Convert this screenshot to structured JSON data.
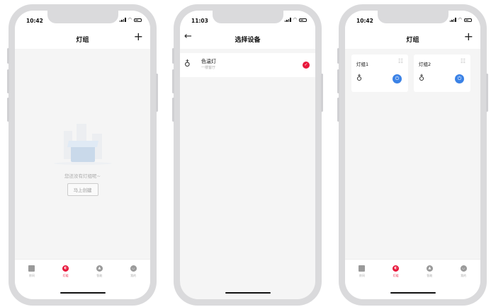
{
  "screens": [
    {
      "time": "10:42",
      "title": "灯组",
      "add_icon": "plus-icon",
      "empty_text": "您还没有灯组呢~",
      "create_button": "马上创建",
      "tabs": [
        {
          "label": "房间",
          "icon": "room-icon",
          "active": false
        },
        {
          "label": "灯组",
          "icon": "light-group-icon",
          "active": true
        },
        {
          "label": "智能",
          "icon": "smart-icon",
          "active": false
        },
        {
          "label": "我的",
          "icon": "profile-icon",
          "active": false
        }
      ]
    },
    {
      "time": "11:03",
      "title": "选择设备",
      "back_icon": "back-arrow-icon",
      "device": {
        "name": "色温灯",
        "location": "一楼客厅",
        "selected": true
      }
    },
    {
      "time": "10:42",
      "title": "灯组",
      "add_icon": "plus-icon",
      "groups": [
        {
          "name": "灯组1",
          "power": true
        },
        {
          "name": "灯组2",
          "power": true
        }
      ],
      "tabs": [
        {
          "label": "房间",
          "icon": "room-icon",
          "active": false
        },
        {
          "label": "灯组",
          "icon": "light-group-icon",
          "active": true
        },
        {
          "label": "智能",
          "icon": "smart-icon",
          "active": false
        },
        {
          "label": "我的",
          "icon": "profile-icon",
          "active": false
        }
      ]
    }
  ],
  "colors": {
    "accent": "#e8183c",
    "power_blue": "#3b82e6"
  }
}
